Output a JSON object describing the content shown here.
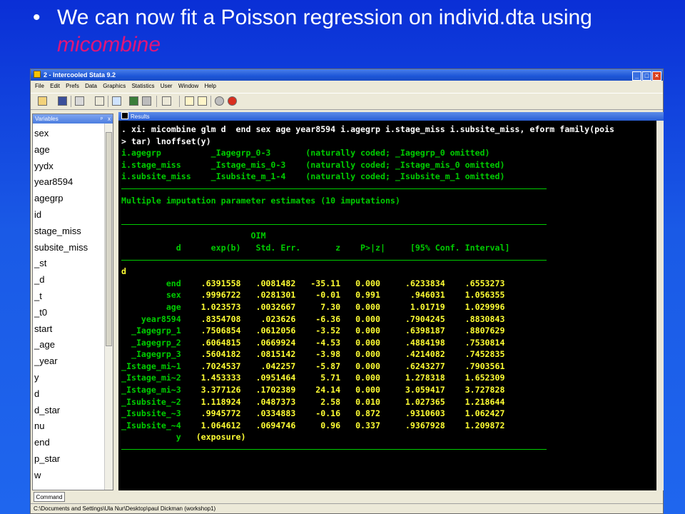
{
  "slide": {
    "bullet": "•",
    "title_pre": "We can now fit a Poisson regression on individ.dta using ",
    "title_kw": "micombine"
  },
  "window": {
    "title": "2 - Intercooled Stata 9.2",
    "buttons": [
      "_",
      "□",
      "×"
    ]
  },
  "menu": [
    "File",
    "Edit",
    "Prefs",
    "Data",
    "Graphics",
    "Statistics",
    "User",
    "Window",
    "Help"
  ],
  "variables": {
    "title": "Variables",
    "pin": "ᵖ",
    "close": "x",
    "items": [
      "sex",
      "age",
      "yydx",
      "year8594",
      "agegrp",
      "id",
      "stage_miss",
      "subsite_miss",
      "_st",
      "_d",
      "_t",
      "_t0",
      "start",
      "_age",
      "_year",
      "y",
      "d",
      "d_star",
      "nu",
      "end",
      "p_star",
      "w"
    ]
  },
  "results": {
    "title": "Results",
    "cmd1": ". xi: micombine glm d  end sex age year8594 i.agegrp i.stage_miss i.subsite_miss, eform family(pois",
    "cmd2": "> tar) lnoffset(y)",
    "xi": [
      "i.agegrp          _Iagegrp_0-3       (naturally coded; _Iagegrp_0 omitted)",
      "i.stage_miss      _Istage_mis_0-3    (naturally coded; _Istage_mis_0 omitted)",
      "i.subsite_miss    _Isubsite_m_1-4    (naturally coded; _Isubsite_m_1 omitted)"
    ],
    "summary": "Multiple imputation parameter estimates (10 imputations)",
    "header1": "                          OIM",
    "header2": "           d      exp(b)   Std. Err.       z    P>|z|     [95% Conf. Interval]",
    "depvar": "d",
    "rows": [
      {
        "name": "         end",
        "vals": "    .6391558   .0081482   -35.11   0.000     .6233834    .6553273"
      },
      {
        "name": "         sex",
        "vals": "    .9996722   .0281301    -0.01   0.991      .946031    1.056355"
      },
      {
        "name": "         age",
        "vals": "    1.023573   .0032667     7.30   0.000      1.01719    1.029996"
      },
      {
        "name": "    year8594",
        "vals": "    .8354708    .023626    -6.36   0.000     .7904245    .8830843"
      },
      {
        "name": "  _Iagegrp_1",
        "vals": "    .7506854   .0612056    -3.52   0.000     .6398187    .8807629"
      },
      {
        "name": "  _Iagegrp_2",
        "vals": "    .6064815   .0669924    -4.53   0.000     .4884198    .7530814"
      },
      {
        "name": "  _Iagegrp_3",
        "vals": "    .5604182   .0815142    -3.98   0.000     .4214082    .7452835"
      },
      {
        "name": "_Istage_mi~1",
        "vals": "    .7024537    .042257    -5.87   0.000     .6243277    .7903561"
      },
      {
        "name": "_Istage_mi~2",
        "vals": "    1.453333   .0951464     5.71   0.000     1.278318    1.652309"
      },
      {
        "name": "_Istage_mi~3",
        "vals": "    3.377126   .1702389    24.14   0.000     3.059417    3.727828"
      },
      {
        "name": "_Isubsite_~2",
        "vals": "    1.118924   .0487373     2.58   0.010     1.027365    1.218644"
      },
      {
        "name": "_Isubsite_~3",
        "vals": "    .9945772   .0334883    -0.16   0.872     .9310603    1.062427"
      },
      {
        "name": "_Isubsite_~4",
        "vals": "    1.064612   .0694746     0.96   0.337     .9367928    1.209872"
      },
      {
        "name": "           y",
        "vals": "   (exposure)"
      }
    ]
  },
  "command": {
    "tab": "Command"
  },
  "status": {
    "path": "C:\\Documents and Settings\\Ula Nur\\Desktop\\paul Dickman (workshop1)"
  }
}
